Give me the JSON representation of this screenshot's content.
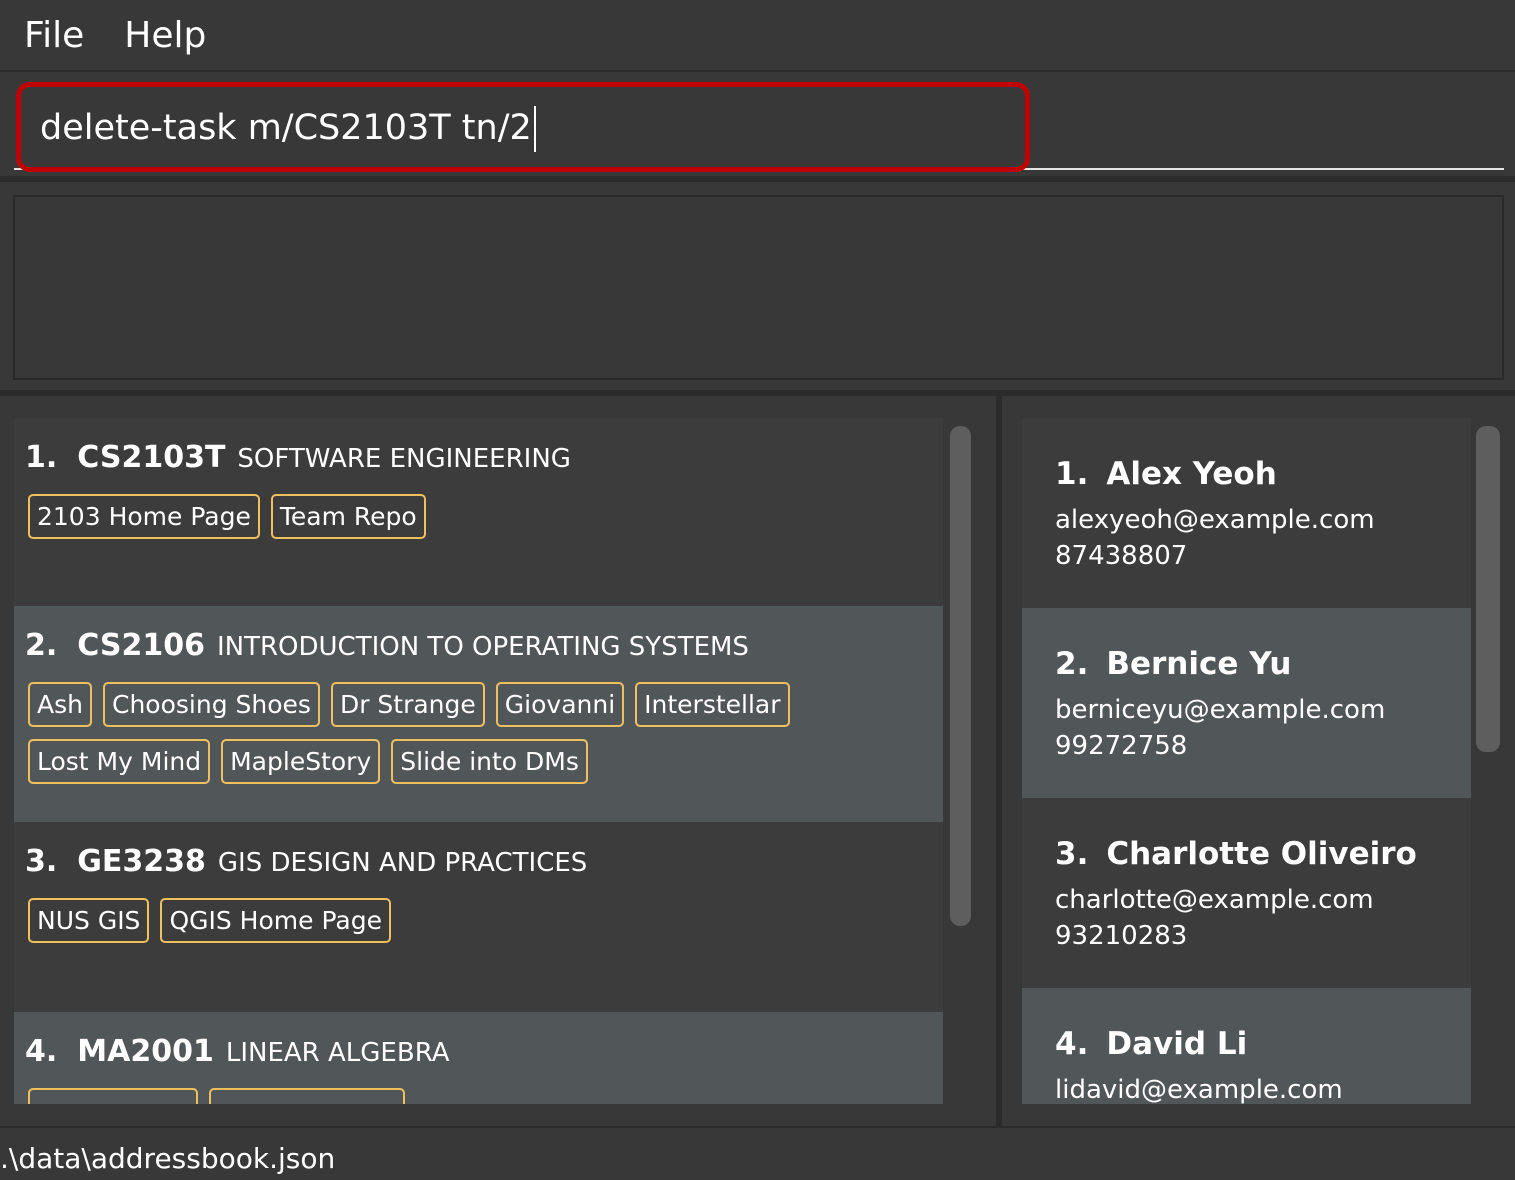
{
  "menu": {
    "file": "File",
    "help": "Help"
  },
  "command": {
    "value": "delete-task m/CS2103T tn/2"
  },
  "result": {
    "text": ""
  },
  "modules": [
    {
      "index": "1.",
      "code": "CS2103T",
      "name": "SOFTWARE ENGINEERING",
      "tags": [
        "2103 Home Page",
        "Team Repo"
      ]
    },
    {
      "index": "2.",
      "code": "CS2106",
      "name": "INTRODUCTION TO OPERATING SYSTEMS",
      "tags": [
        "Ash",
        "Choosing Shoes",
        "Dr Strange",
        "Giovanni",
        "Interstellar",
        "Lost My Mind",
        "MapleStory",
        "Slide into DMs"
      ]
    },
    {
      "index": "3.",
      "code": "GE3238",
      "name": "GIS DESIGN AND PRACTICES",
      "tags": [
        "NUS GIS",
        "QGIS Home Page"
      ]
    },
    {
      "index": "4.",
      "code": "MA2001",
      "name": "LINEAR ALGEBRA",
      "tags": [
        "",
        ""
      ]
    }
  ],
  "persons": [
    {
      "index": "1.",
      "name": "Alex Yeoh",
      "email": "alexyeoh@example.com",
      "phone": "87438807"
    },
    {
      "index": "2.",
      "name": "Bernice Yu",
      "email": "berniceyu@example.com",
      "phone": "99272758"
    },
    {
      "index": "3.",
      "name": "Charlotte Oliveiro",
      "email": "charlotte@example.com",
      "phone": "93210283"
    },
    {
      "index": "4.",
      "name": "David Li",
      "email": "lidavid@example.com",
      "phone": ""
    }
  ],
  "status": {
    "path": ".\\data\\addressbook.json"
  },
  "colors": {
    "background": "#383838",
    "card_alt": "#515658",
    "tag_border": "#f0c060",
    "highlight": "#c00000"
  }
}
